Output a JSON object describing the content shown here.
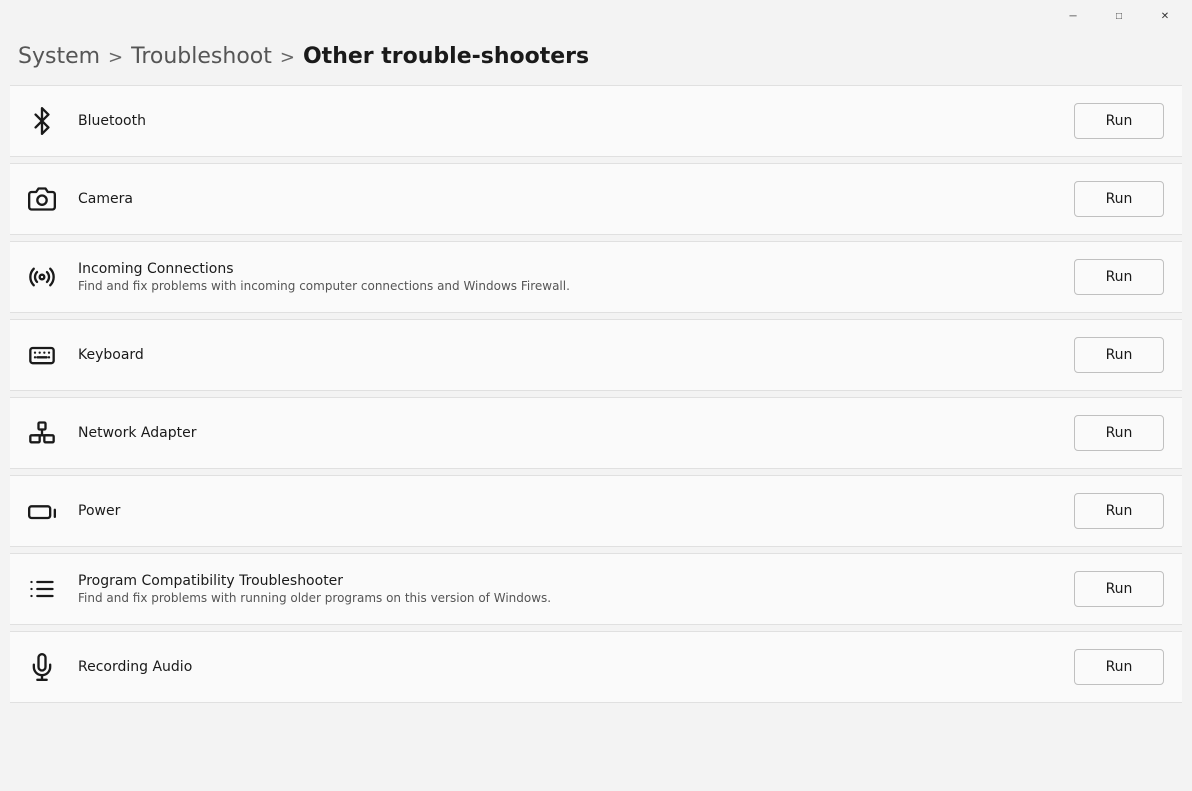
{
  "titleBar": {
    "minimizeLabel": "─",
    "maximizeLabel": "□",
    "closeLabel": "✕"
  },
  "breadcrumb": {
    "system": "System",
    "sep1": ">",
    "troubleshoot": "Troubleshoot",
    "sep2": ">",
    "current": "Other trouble-shooters"
  },
  "items": [
    {
      "id": "bluetooth",
      "title": "Bluetooth",
      "description": "",
      "icon": "bluetooth",
      "runLabel": "Run"
    },
    {
      "id": "camera",
      "title": "Camera",
      "description": "",
      "icon": "camera",
      "runLabel": "Run"
    },
    {
      "id": "incoming-connections",
      "title": "Incoming Connections",
      "description": "Find and fix problems with incoming computer connections and Windows Firewall.",
      "icon": "incoming",
      "runLabel": "Run"
    },
    {
      "id": "keyboard",
      "title": "Keyboard",
      "description": "",
      "icon": "keyboard",
      "runLabel": "Run"
    },
    {
      "id": "network-adapter",
      "title": "Network Adapter",
      "description": "",
      "icon": "network",
      "runLabel": "Run"
    },
    {
      "id": "power",
      "title": "Power",
      "description": "",
      "icon": "power",
      "runLabel": "Run"
    },
    {
      "id": "program-compatibility",
      "title": "Program Compatibility Troubleshooter",
      "description": "Find and fix problems with running older programs on this version of Windows.",
      "icon": "program",
      "runLabel": "Run"
    },
    {
      "id": "recording-audio",
      "title": "Recording Audio",
      "description": "",
      "icon": "audio",
      "runLabel": "Run"
    }
  ]
}
